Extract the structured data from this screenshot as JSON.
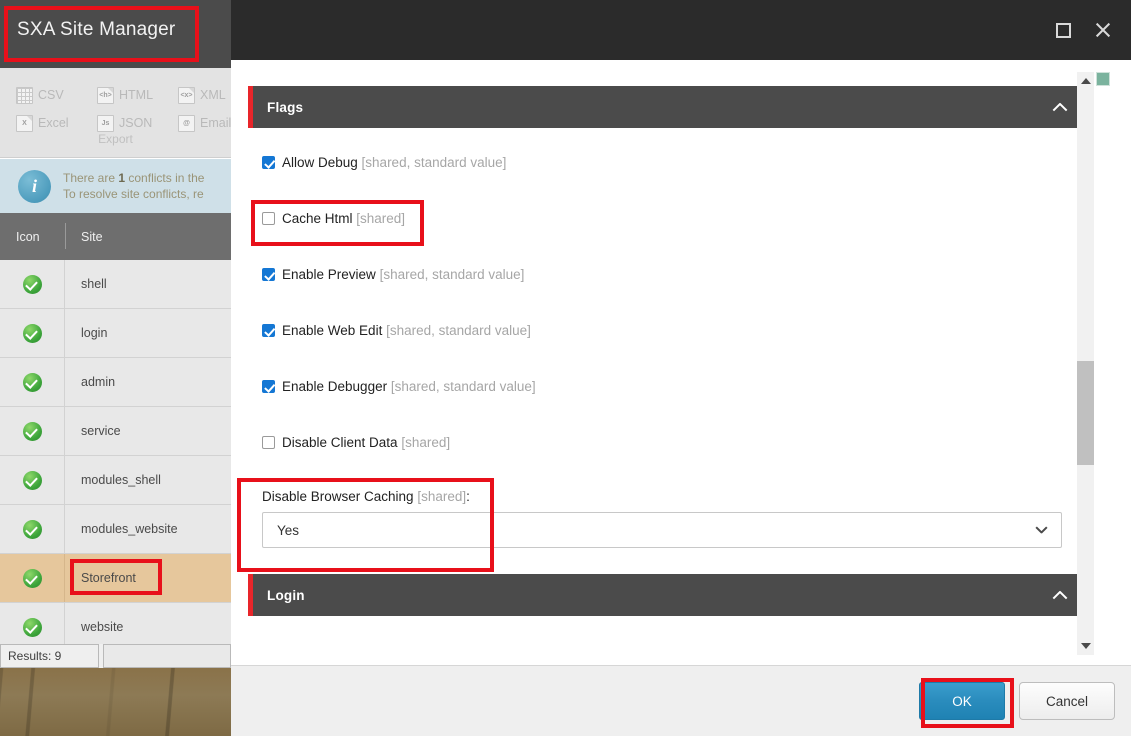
{
  "app": {
    "title": "SXA Site Manager",
    "export_group_label": "Export",
    "export_items": [
      {
        "label": "CSV",
        "icon": "csv-grid-icon"
      },
      {
        "label": "HTML",
        "icon": "html-doc-icon"
      },
      {
        "label": "XML",
        "icon": "xml-doc-icon"
      },
      {
        "label": "Excel",
        "icon": "excel-doc-icon"
      },
      {
        "label": "JSON",
        "icon": "json-doc-icon"
      },
      {
        "label": "Email",
        "icon": "email-doc-icon"
      }
    ],
    "info": {
      "icon": "info-circle-icon",
      "line1_prefix": "There are ",
      "line1_count": "1",
      "line1_suffix": " conflicts in the",
      "line2": "To resolve site conflicts, re"
    },
    "table": {
      "columns": [
        "Icon",
        "Site"
      ],
      "rows": [
        {
          "status": "ok",
          "site": "shell",
          "selected": false
        },
        {
          "status": "ok",
          "site": "login",
          "selected": false
        },
        {
          "status": "ok",
          "site": "admin",
          "selected": false
        },
        {
          "status": "ok",
          "site": "service",
          "selected": false
        },
        {
          "status": "ok",
          "site": "modules_shell",
          "selected": false
        },
        {
          "status": "ok",
          "site": "modules_website",
          "selected": false
        },
        {
          "status": "ok",
          "site": "Storefront",
          "selected": true
        },
        {
          "status": "ok",
          "site": "website",
          "selected": false
        }
      ],
      "results_label": "Results: 9"
    }
  },
  "dialog": {
    "window_controls": {
      "maximize": "maximize-icon",
      "close": "close-icon"
    },
    "sections": [
      {
        "title": "Flags",
        "collapse_icon": "chevron-up-icon"
      },
      {
        "title": "Login",
        "collapse_icon": "chevron-up-icon"
      }
    ],
    "flags": [
      {
        "label": "Allow Debug",
        "suffix": " [shared, standard value]",
        "checked": true
      },
      {
        "label": "Cache Html",
        "suffix": " [shared]",
        "checked": false
      },
      {
        "label": "Enable Preview",
        "suffix": " [shared, standard value]",
        "checked": true
      },
      {
        "label": "Enable Web Edit",
        "suffix": " [shared, standard value]",
        "checked": true
      },
      {
        "label": "Enable Debugger",
        "suffix": " [shared, standard value]",
        "checked": true
      },
      {
        "label": "Disable Client Data",
        "suffix": " [shared]",
        "checked": false
      }
    ],
    "select_field": {
      "label": "Disable Browser Caching",
      "label_suffix": " [shared]",
      "label_colon": ":",
      "value": "Yes",
      "chevron": "chevron-down-icon"
    },
    "scrollbar": {
      "up_icon": "scroll-up-arrow-icon",
      "down_icon": "scroll-down-arrow-icon"
    },
    "status_marker": "green-status-square",
    "footer": {
      "ok_label": "OK",
      "cancel_label": "Cancel"
    }
  },
  "colors": {
    "accent_red": "#e8101a",
    "section_header_bg": "#4b4b4b",
    "checkbox_checked": "#1477d4",
    "ok_button": "#2a8cbd",
    "selected_row": "#e6c79c",
    "status_green": "#3da53b",
    "marker_green": "#7bb39e"
  }
}
